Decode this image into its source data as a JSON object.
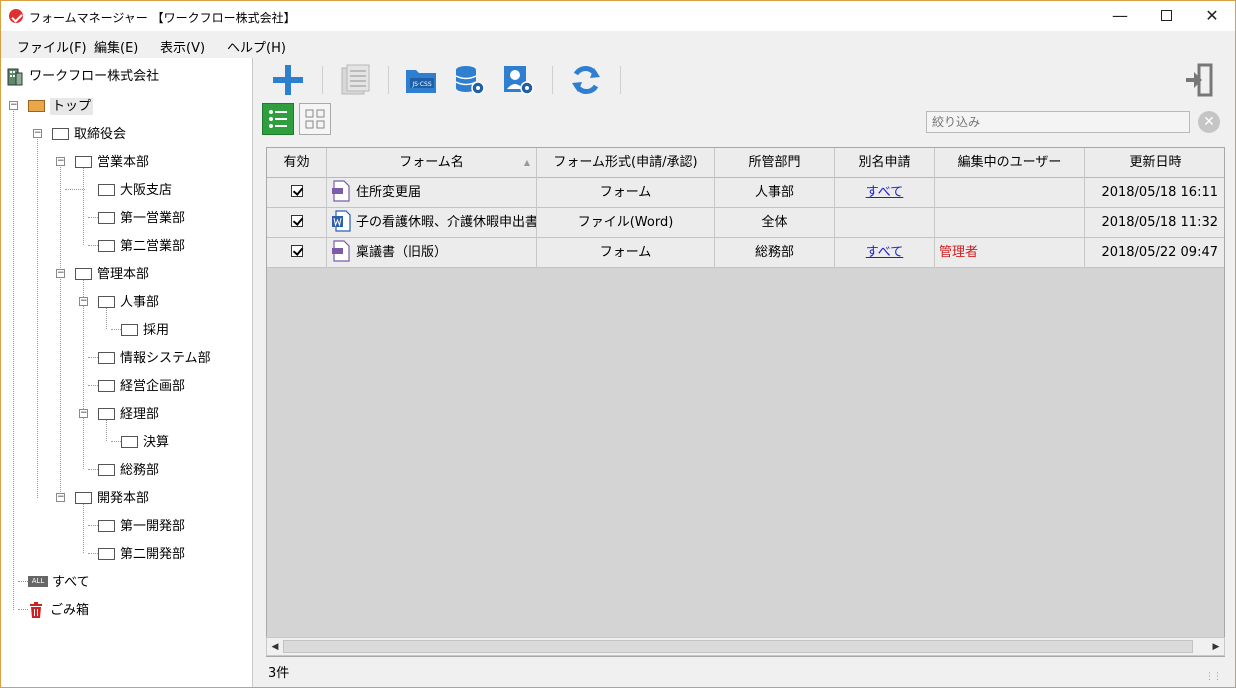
{
  "window": {
    "title": "フォームマネージャー 【ワークフロー株式会社】"
  },
  "menu": [
    "ファイル(F)",
    "編集(E)",
    "表示(V)",
    "ヘルプ(H)"
  ],
  "tree": {
    "root": "ワークフロー株式会社",
    "nodes": {
      "top": "トップ",
      "board": "取締役会",
      "sales": "営業本部",
      "osaka": "大阪支店",
      "sales1": "第一営業部",
      "sales2": "第二営業部",
      "admin": "管理本部",
      "hr": "人事部",
      "recruit": "採用",
      "infosys": "情報システム部",
      "planning": "経営企画部",
      "accounting": "経理部",
      "settlement": "決算",
      "general": "総務部",
      "dev": "開発本部",
      "dev1": "第一開発部",
      "dev2": "第二開発部",
      "all": "すべて",
      "trash": "ごみ箱"
    },
    "all_badge": "ALL"
  },
  "toolbar": {
    "icons": [
      "add-icon",
      "list-document-icon",
      "folder-js-css-icon",
      "database-settings-icon",
      "user-settings-icon",
      "refresh-icon",
      "exit-icon"
    ],
    "js_css_label": "JS·CSS"
  },
  "filter": {
    "placeholder": "絞り込み"
  },
  "grid": {
    "headers": [
      "有効",
      "フォーム名",
      "フォーム形式(申請/承認)",
      "所管部門",
      "別名申請",
      "編集中のユーザー",
      "更新日時"
    ],
    "rows": [
      {
        "enabled": true,
        "icon": "web-form-icon",
        "name": "住所変更届",
        "format": "フォーム",
        "dept": "人事部",
        "alias": "すべて",
        "editor": "",
        "updated": "2018/05/18 16:11"
      },
      {
        "enabled": true,
        "icon": "word-file-icon",
        "name": "子の看護休暇、介護休暇申出書",
        "format": "ファイル(Word)",
        "dept": "全体",
        "alias": "",
        "editor": "",
        "updated": "2018/05/18 11:32"
      },
      {
        "enabled": true,
        "icon": "web-form-icon",
        "name": "稟議書（旧版）",
        "format": "フォーム",
        "dept": "総務部",
        "alias": "すべて",
        "editor": "管理者",
        "updated": "2018/05/22 09:47"
      }
    ]
  },
  "status": {
    "count": "3件"
  },
  "colors": {
    "accent_blue": "#2f7fd0",
    "active_view": "#2e9e3e",
    "editor_red": "#d02020",
    "link_blue": "#2020d0"
  }
}
